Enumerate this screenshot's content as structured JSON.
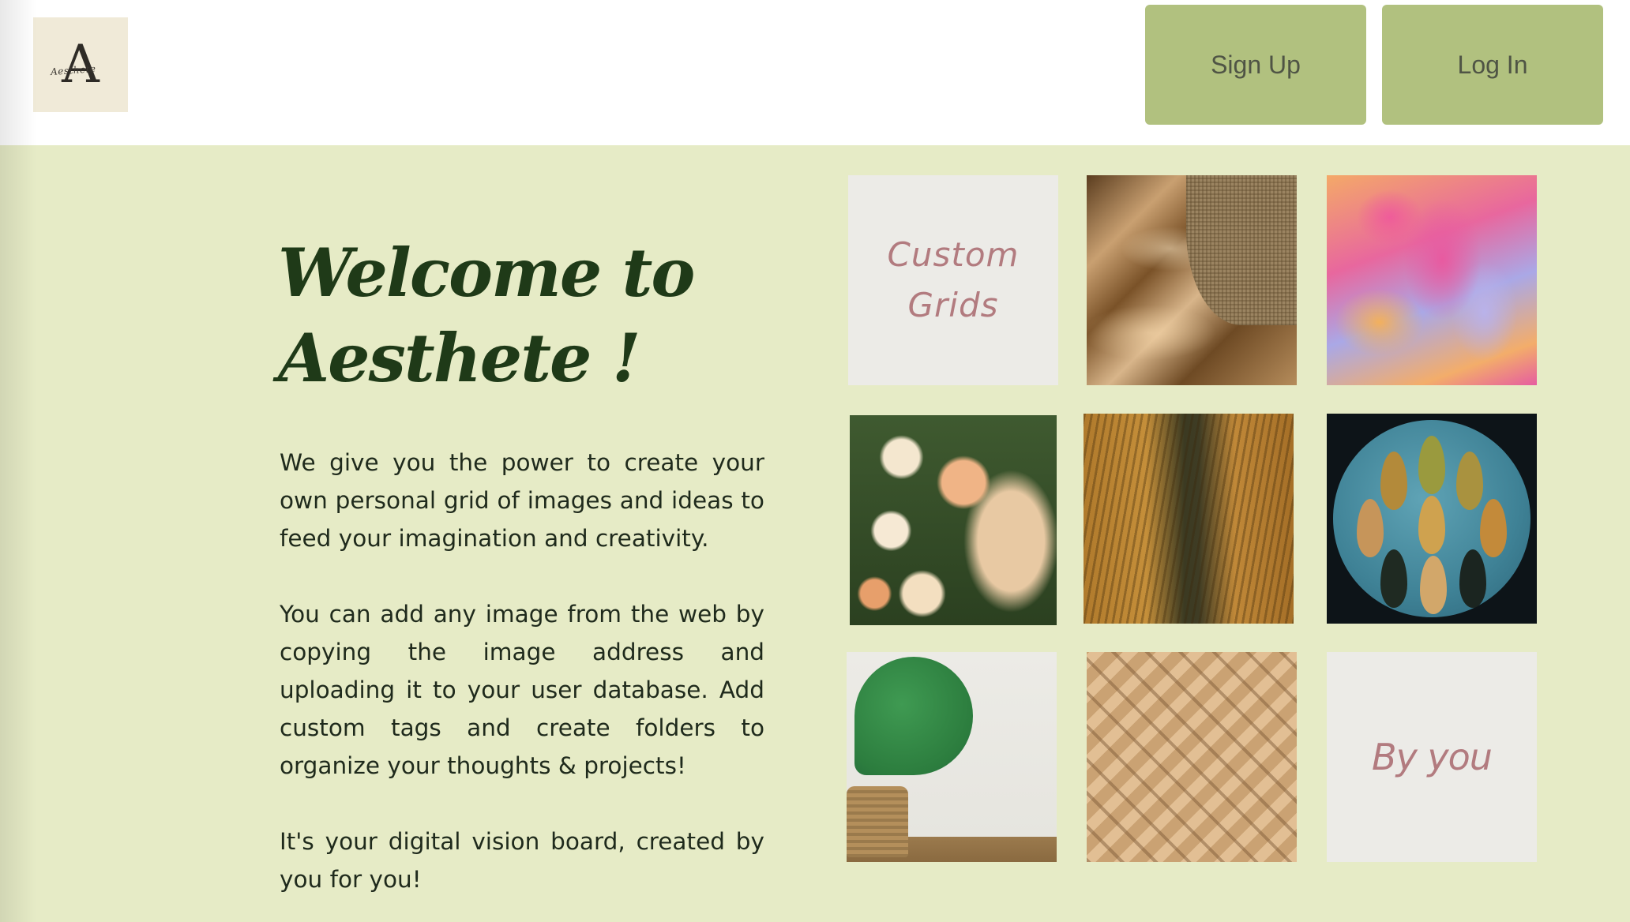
{
  "header": {
    "logo_letter": "A",
    "logo_script": "Aesthete",
    "signup_label": "Sign Up",
    "login_label": "Log In"
  },
  "hero": {
    "title_line1": "Welcome to",
    "title_line2": "Aesthete !",
    "paragraphs": [
      "We give you the power to create your own personal grid of images and ideas to feed your imagination and creativity.",
      "You can add any image from the web by copying the image address and uploading it to your user database. Add custom tags and create folders to organize your thoughts & projects!",
      "It's your digital vision board, created by you for you!"
    ]
  },
  "grid": {
    "tile1_line1": "Custom",
    "tile1_line2": "Grids",
    "tile9_text": "By you"
  },
  "colors": {
    "background": "#e6ebc6",
    "button": "#b1c17f",
    "heading": "#1f3a18",
    "tile_text": "#b27b7f"
  }
}
